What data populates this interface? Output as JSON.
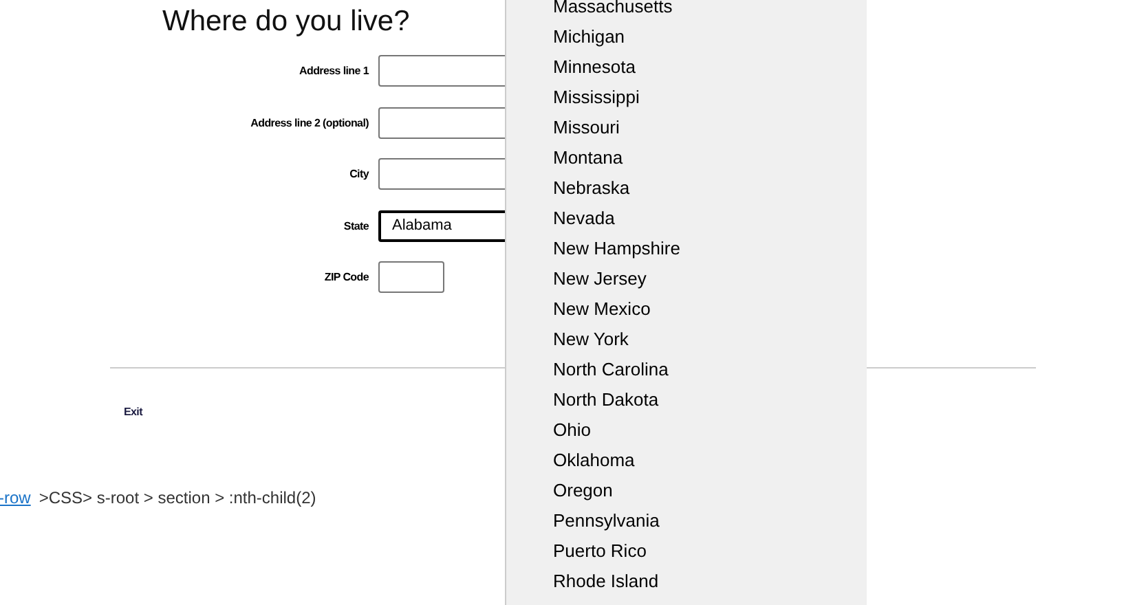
{
  "heading": "Where do you live?",
  "fields": [
    {
      "label": "Address line 1",
      "kind": "text"
    },
    {
      "label": "Address line 2 (optional)",
      "kind": "text"
    },
    {
      "label": "City",
      "kind": "text"
    },
    {
      "label": "State",
      "kind": "select",
      "value": "Alabama"
    },
    {
      "label": "ZIP Code",
      "kind": "zip"
    }
  ],
  "exit_link": "Exit",
  "inspector_path": {
    "link": "-row",
    "path": ">CSS> s-root > section > :nth-child(2)"
  },
  "state_dropdown": {
    "options": [
      {
        "label": "Massachusetts",
        "selected": false
      },
      {
        "label": "Michigan",
        "selected": false
      },
      {
        "label": "Minnesota",
        "selected": false
      },
      {
        "label": "Mississippi",
        "selected": false
      },
      {
        "label": "Missouri",
        "selected": false
      },
      {
        "label": "Montana",
        "selected": false
      },
      {
        "label": "Nebraska",
        "selected": false
      },
      {
        "label": "Nevada",
        "selected": false
      },
      {
        "label": "New Hampshire",
        "selected": false
      },
      {
        "label": "New Jersey",
        "selected": false
      },
      {
        "label": "New Mexico",
        "selected": false
      },
      {
        "label": "New York",
        "selected": false
      },
      {
        "label": "North Carolina",
        "selected": false
      },
      {
        "label": "North Dakota",
        "selected": false
      },
      {
        "label": "Ohio",
        "selected": false
      },
      {
        "label": "Oklahoma",
        "selected": false
      },
      {
        "label": "Oregon",
        "selected": false
      },
      {
        "label": "Pennsylvania",
        "selected": false
      },
      {
        "label": "Puerto Rico",
        "selected": false
      },
      {
        "label": "Rhode Island",
        "selected": false
      }
    ]
  }
}
